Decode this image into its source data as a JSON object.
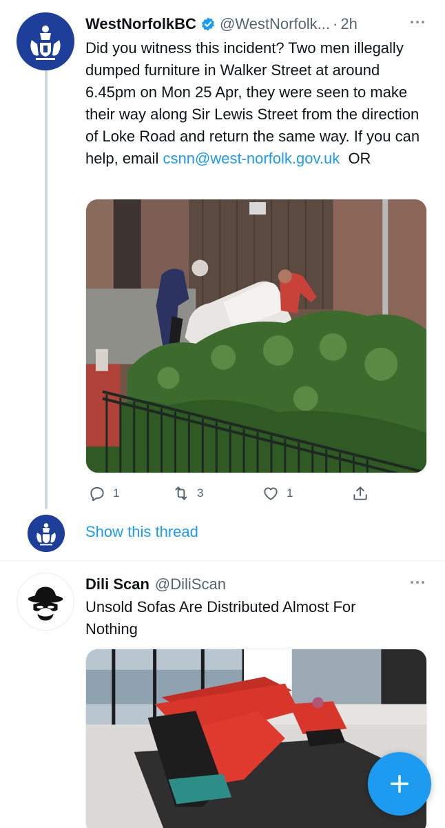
{
  "colors": {
    "accent": "#1d9bf0",
    "text_primary": "#0f1419",
    "text_secondary": "#536471",
    "council_blue": "#1d3f9a"
  },
  "tweets": [
    {
      "author": {
        "display_name": "WestNorfolkBC",
        "handle": "@WestNorfolk...",
        "verified": true,
        "avatar_icon": "council-crest-icon"
      },
      "separator": "·",
      "time": "2h",
      "text_main": "Did you witness this incident? Two men illegally dumped furniture in Walker Street at around 6.45pm on Mon 25 Apr, they were seen to make their way along Sir Lewis Street from the direction of Loke Road and return the same way. If you can help, email ",
      "text_link": "csnn@west-norfolk.gov.uk",
      "text_tail": "  OR",
      "media_description_icon": "cctv-photo-image",
      "actions": {
        "reply_count": "1",
        "retweet_count": "3",
        "like_count": "1"
      },
      "show_thread_label": "Show this thread"
    },
    {
      "author": {
        "display_name": "Dili Scan",
        "handle": "@DiliScan",
        "verified": false,
        "avatar_icon": "spy-hat-icon"
      },
      "text": "Unsold Sofas Are Distributed Almost For Nothing",
      "media_description_icon": "red-sofa-photo-image"
    }
  ],
  "fab": {
    "icon": "plus-icon"
  }
}
